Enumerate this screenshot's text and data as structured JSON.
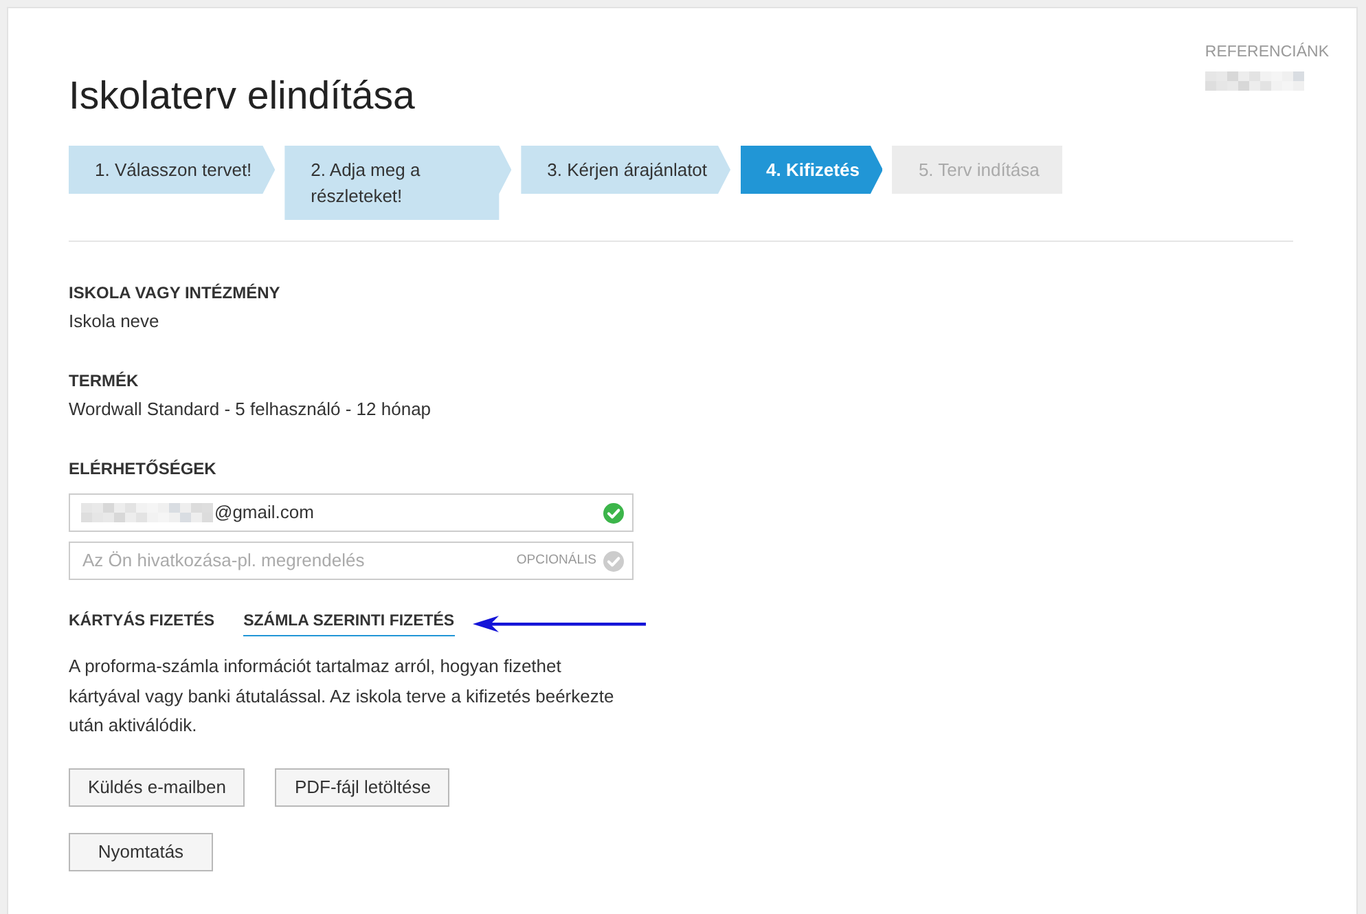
{
  "page": {
    "title": "Iskolaterv elindítása",
    "reference": {
      "label": "REFERENCIÁNK",
      "redacted": true
    }
  },
  "steps": [
    {
      "label": "1. Válasszon tervet!",
      "completed": true,
      "selected": false
    },
    {
      "label": "2. Adja meg a részleteket!",
      "completed": true,
      "selected": false
    },
    {
      "label": "3. Kérjen árajánlatot",
      "completed": true,
      "selected": false
    },
    {
      "label": "4. Kifizetés",
      "completed": false,
      "selected": true
    },
    {
      "label": "5. Terv indítása",
      "completed": false,
      "selected": false
    }
  ],
  "sections": [
    {
      "heading": "ISKOLA VAGY INTÉZMÉNY",
      "value": "Iskola neve"
    },
    {
      "heading": "TERMÉK",
      "value": "Wordwall Standard - 5 felhasználó - 12 hónap"
    }
  ],
  "contacts": {
    "heading": "ELÉRHETŐSÉGEK",
    "fields": [
      {
        "value": "@gmail.com",
        "redacted_prefix": true,
        "valid": true
      },
      {
        "placeholder": "Az Ön hivatkozása-pl. megrendelés",
        "badge": "OPCIONÁLIS",
        "valid": false
      }
    ]
  },
  "payment": {
    "tabs": [
      {
        "label": "KÁRTYÁS FIZETÉS",
        "selected": false
      },
      {
        "label": "SZÁMLA SZERINTI FIZETÉS",
        "selected": true
      }
    ],
    "description": "A proforma-számla információt tartalmaz arról, hogyan fizethet kártyával vagy banki átutalással. Az iskola terve a kifizetés beérkezte után aktiválódik.",
    "button_rows": [
      [
        {
          "label": "Küldés e-mailben"
        },
        {
          "label": "PDF-fájl letöltése"
        }
      ],
      [
        {
          "label": "Nyomtatás"
        }
      ]
    ]
  }
}
